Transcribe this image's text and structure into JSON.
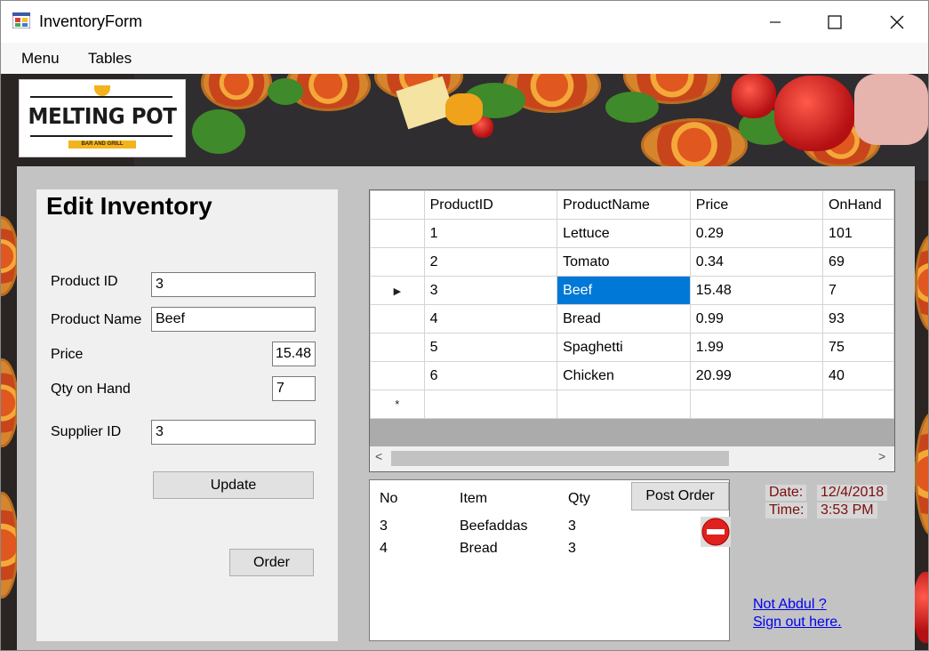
{
  "window": {
    "title": "InventoryForm",
    "minimize": "—",
    "maximize": "☐",
    "close": "✕"
  },
  "menu": {
    "items": [
      "Menu",
      "Tables"
    ]
  },
  "logo": {
    "name": "MELTING POT",
    "tagline": "BAR AND GRILL"
  },
  "edit": {
    "title": "Edit Inventory",
    "product_id_label": "Product ID",
    "product_id_value": "3",
    "product_name_label": "Product Name",
    "product_name_value": "Beef",
    "price_label": "Price",
    "price_value": "15.48",
    "qty_label": "Qty on Hand",
    "qty_value": "7",
    "supplier_label": "Supplier ID",
    "supplier_value": "3",
    "update_label": "Update",
    "order_label": "Order"
  },
  "grid": {
    "columns": [
      "ProductID",
      "ProductName",
      "Price",
      "OnHand"
    ],
    "rows": [
      [
        "1",
        "Lettuce",
        "0.29",
        "101"
      ],
      [
        "2",
        "Tomato",
        "0.34",
        "69"
      ],
      [
        "3",
        "Beef",
        "15.48",
        "7"
      ],
      [
        "4",
        "Bread",
        "0.99",
        "93"
      ],
      [
        "5",
        "Spaghetti",
        "1.99",
        "75"
      ],
      [
        "6",
        "Chicken",
        "20.99",
        "40"
      ]
    ],
    "current_row_marker": "▶",
    "new_row_marker": "*",
    "scroll_left": "<",
    "scroll_right": ">"
  },
  "orders": {
    "columns": [
      "No",
      "Item",
      "Qty"
    ],
    "rows": [
      [
        "3",
        "Beefaddas",
        "3"
      ],
      [
        "4",
        "Bread",
        "3"
      ]
    ],
    "post_label": "Post Order"
  },
  "datetime": {
    "date_label": "Date:",
    "date_value": "12/4/2018",
    "time_label": "Time:",
    "time_value": "3:53 PM"
  },
  "signout": {
    "line1": "Not Abdul ?",
    "line2": "Sign out here."
  },
  "colors": {
    "selection": "#0078d7",
    "link": "#0000ee",
    "datetime_text": "#7a0d0d"
  }
}
